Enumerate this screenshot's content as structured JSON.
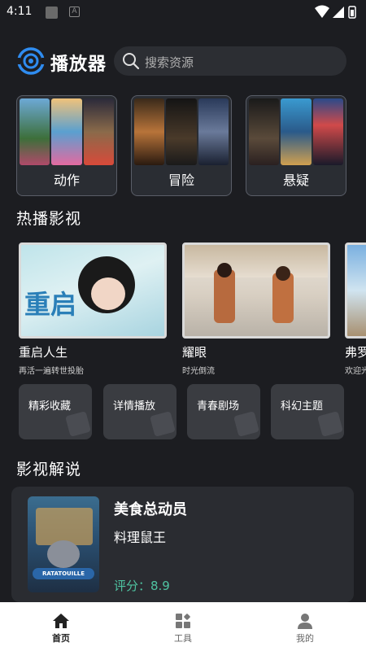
{
  "status": {
    "time": "4:11"
  },
  "header": {
    "app_name": "播放器",
    "search_placeholder": "搜索资源"
  },
  "categories": [
    {
      "label": "动作"
    },
    {
      "label": "冒险"
    },
    {
      "label": "悬疑"
    }
  ],
  "hot": {
    "section_title": "热播影视",
    "items": [
      {
        "title": "重启人生",
        "subtitle": "再活一遍转世投胎",
        "thumb_text": "重启"
      },
      {
        "title": "耀眼",
        "subtitle": "时光倒流"
      },
      {
        "title": "弗罗",
        "subtitle": "欢迎光"
      }
    ]
  },
  "tiles": [
    {
      "label": "精彩收藏"
    },
    {
      "label": "详情播放"
    },
    {
      "label": "青春剧场"
    },
    {
      "label": "科幻主题"
    }
  ],
  "reviews": {
    "section_title": "影视解说",
    "items": [
      {
        "title": "美食总动员",
        "subtitle": "料理鼠王",
        "score": "评分：8.9",
        "poster_text": "RATATOUILLE"
      }
    ]
  },
  "tabbar": {
    "items": [
      {
        "label": "首页",
        "icon": "home-icon",
        "active": true
      },
      {
        "label": "工具",
        "icon": "grid-icon",
        "active": false
      },
      {
        "label": "我的",
        "icon": "user-icon",
        "active": false
      }
    ]
  },
  "colors": {
    "background": "#1c1d21",
    "accent": "#2f8cf0",
    "score": "#4fc3a1"
  }
}
